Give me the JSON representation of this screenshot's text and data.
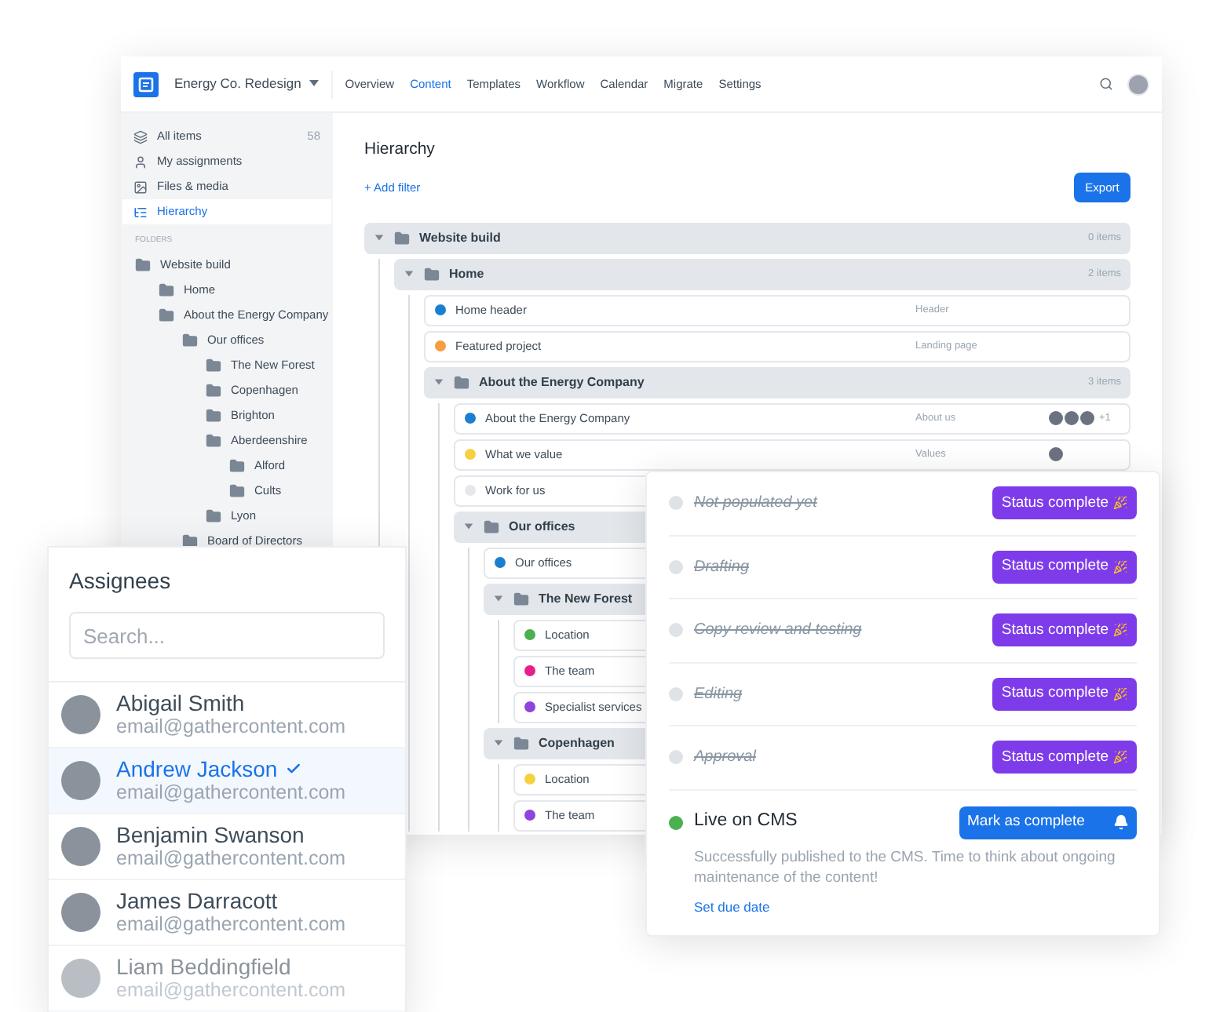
{
  "app": {
    "project": "Energy Co. Redesign",
    "nav": [
      {
        "label": "Overview",
        "selected": false
      },
      {
        "label": "Content",
        "selected": true
      },
      {
        "label": "Templates",
        "selected": false
      },
      {
        "label": "Workflow",
        "selected": false
      },
      {
        "label": "Calendar",
        "selected": false
      },
      {
        "label": "Migrate",
        "selected": false
      },
      {
        "label": "Settings",
        "selected": false
      }
    ],
    "sidebar": {
      "items": [
        {
          "label": "All items",
          "count": "58",
          "selected": false
        },
        {
          "label": "My assignments",
          "selected": false
        },
        {
          "label": "Files & media",
          "selected": false
        },
        {
          "label": "Hierarchy",
          "selected": true
        }
      ],
      "folders_heading": "FOLDERS",
      "folders": [
        {
          "name": "Website build",
          "children": [
            {
              "name": "Home"
            },
            {
              "name": "About the Energy Company",
              "children": [
                {
                  "name": "Our offices",
                  "children": [
                    {
                      "name": "The New Forest"
                    },
                    {
                      "name": "Copenhagen"
                    },
                    {
                      "name": "Brighton"
                    },
                    {
                      "name": "Aberdeenshire",
                      "children": [
                        {
                          "name": "Alford"
                        },
                        {
                          "name": "Cults"
                        }
                      ]
                    },
                    {
                      "name": "Lyon"
                    }
                  ]
                },
                {
                  "name": "Board of Directors"
                }
              ]
            }
          ]
        }
      ]
    },
    "title": "Hierarchy",
    "add_filter": "+ Add filter",
    "export": "Export",
    "tree": [
      {
        "kind": "folder",
        "name": "Website build",
        "count": "0 items",
        "expanded": true,
        "children": [
          {
            "kind": "folder",
            "name": "Home",
            "count": "2 items",
            "expanded": true,
            "children": [
              {
                "kind": "item",
                "name": "Home header",
                "color": "#1a7fd0",
                "template": "Header"
              },
              {
                "kind": "item",
                "name": "Featured project",
                "color": "#f59e42",
                "template": "Landing page"
              },
              {
                "kind": "folder",
                "name": "About the Energy Company",
                "count": "3 items",
                "expanded": true,
                "children": [
                  {
                    "kind": "item",
                    "name": "About the Energy Company",
                    "color": "#1a7fd0",
                    "template": "About us",
                    "assignees": [
                      {
                        "kind": "avatar"
                      },
                      {
                        "kind": "avatar"
                      },
                      {
                        "kind": "avatar"
                      }
                    ],
                    "more": "+1"
                  },
                  {
                    "kind": "item",
                    "name": "What we value",
                    "color": "#f5d142",
                    "template": "Values",
                    "assignees": [
                      {
                        "kind": "avatar"
                      }
                    ]
                  },
                  {
                    "kind": "item",
                    "name": "Work for us",
                    "color": "#e5e7eb"
                  },
                  {
                    "kind": "folder",
                    "name": "Our offices",
                    "expanded": true,
                    "children": [
                      {
                        "kind": "item",
                        "name": "Our offices",
                        "color": "#1a7fd0"
                      },
                      {
                        "kind": "folder",
                        "name": "The New Forest",
                        "expanded": true,
                        "children": [
                          {
                            "kind": "item",
                            "name": "Location",
                            "color": "#4caf50"
                          },
                          {
                            "kind": "item",
                            "name": "The team",
                            "color": "#e91e8c"
                          },
                          {
                            "kind": "item",
                            "name": "Specialist services",
                            "color": "#8e44dd"
                          }
                        ]
                      },
                      {
                        "kind": "folder",
                        "name": "Copenhagen",
                        "expanded": true,
                        "children": [
                          {
                            "kind": "item",
                            "name": "Location",
                            "color": "#f5d142"
                          },
                          {
                            "kind": "item",
                            "name": "The team",
                            "color": "#8e44dd"
                          }
                        ]
                      }
                    ]
                  }
                ]
              }
            ]
          }
        ]
      }
    ]
  },
  "assignees": {
    "title": "Assignees",
    "search": {
      "placeholder": "Search..."
    },
    "people": [
      {
        "name": "Abigail Smith",
        "email": "email@gathercontent.com",
        "selected": false
      },
      {
        "name": "Andrew Jackson",
        "email": "email@gathercontent.com",
        "selected": true
      },
      {
        "name": "Benjamin Swanson",
        "email": "email@gathercontent.com",
        "selected": false
      },
      {
        "name": "James Darracott",
        "email": "email@gathercontent.com",
        "selected": false
      },
      {
        "name": "Liam Beddingfield",
        "email": "email@gathercontent.com",
        "selected": false
      }
    ]
  },
  "workflow": {
    "steps": [
      {
        "name": "Not populated yet",
        "completed": true,
        "button": "Status complete"
      },
      {
        "name": "Drafting",
        "completed": true,
        "button": "Status complete"
      },
      {
        "name": "Copy review and testing",
        "completed": true,
        "button": "Status complete"
      },
      {
        "name": "Editing",
        "completed": true,
        "button": "Status complete"
      },
      {
        "name": "Approval",
        "completed": true,
        "button": "Status complete"
      },
      {
        "name": "Live on CMS",
        "completed": false,
        "button": "Mark as complete",
        "description": "Successfully published to the CMS. Time to think about ongoing maintenance of the content!",
        "link": "Set due date"
      }
    ]
  }
}
